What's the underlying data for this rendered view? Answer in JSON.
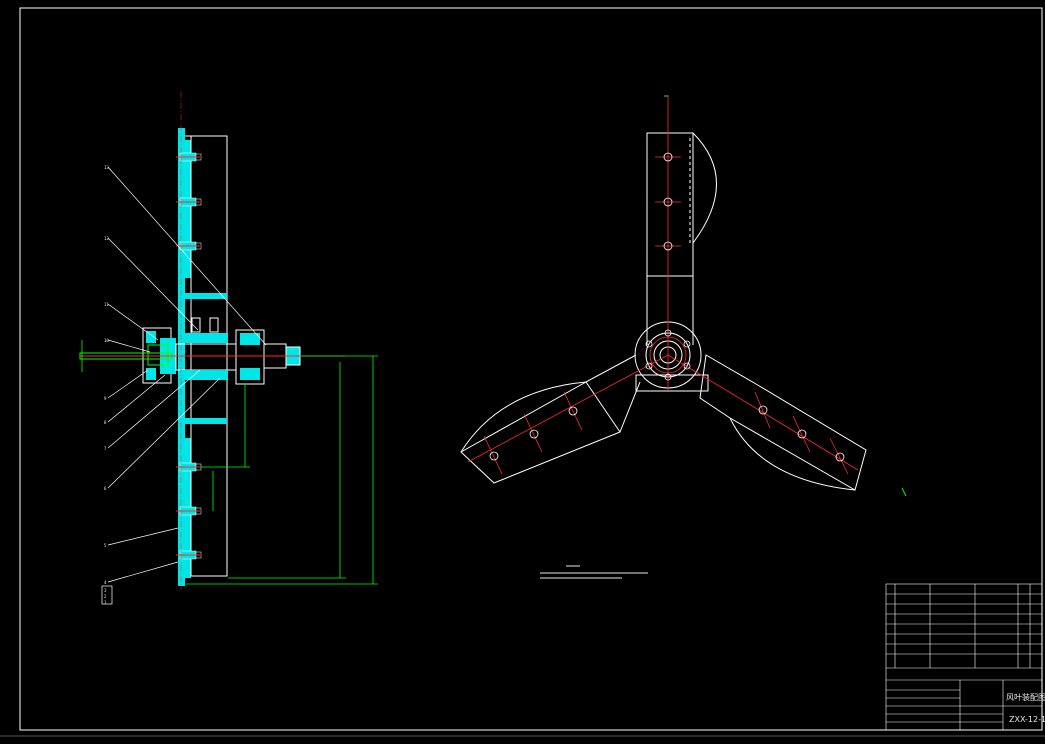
{
  "drawing": {
    "title_block": {
      "drawing_number": "ZXX-12-1",
      "drawing_name": "风叶装配图"
    },
    "balloons": [
      "1",
      "2",
      "3",
      "4",
      "5",
      "6",
      "7",
      "8",
      "9",
      "10",
      "11",
      "12",
      "13"
    ],
    "colors": {
      "background": "#000000",
      "outline": "#ffffff",
      "section_fill": "#00e5e5",
      "dimension": "#00ff00",
      "centerline": "#ff2a2a",
      "bolt_marker": "#ff2a2a"
    },
    "icons": [
      "bolt-head-icon",
      "hub-icon"
    ]
  }
}
